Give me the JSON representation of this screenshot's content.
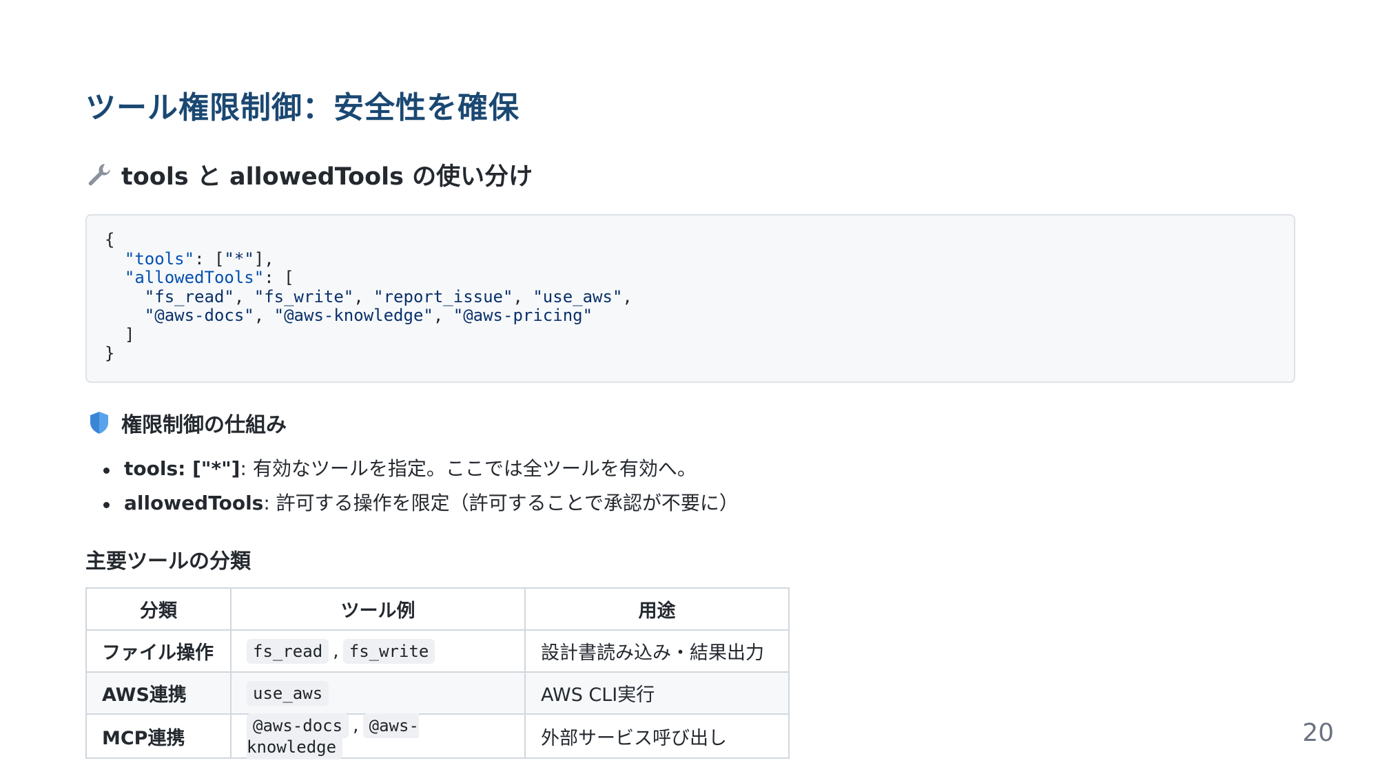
{
  "title": "ツール権限制御：安全性を確保",
  "section_tools": {
    "icon": "wrench-icon",
    "heading": "tools と allowedTools の使い分け"
  },
  "code": {
    "lines": [
      "{",
      "  \"tools\": [\"*\"],",
      "  \"allowedTools\": [",
      "    \"fs_read\", \"fs_write\", \"report_issue\", \"use_aws\",",
      "    \"@aws-docs\", \"@aws-knowledge\", \"@aws-pricing\"",
      "  ]",
      "}"
    ]
  },
  "section_perm": {
    "icon": "shield-icon",
    "heading": "権限制御の仕組み",
    "bullets": [
      {
        "term": "tools: [\"*\"]",
        "text": ": 有効なツールを指定。ここでは全ツールを有効へ。"
      },
      {
        "term": "allowedTools",
        "text": ": 許可する操作を限定（許可することで承認が不要に）"
      }
    ]
  },
  "section_table": {
    "heading": "主要ツールの分類",
    "columns": [
      "分類",
      "ツール例",
      "用途"
    ],
    "rows": [
      {
        "category": "ファイル操作",
        "tools": [
          "fs_read",
          "fs_write"
        ],
        "use": "設計書読み込み・結果出力"
      },
      {
        "category": "AWS連携",
        "tools": [
          "use_aws"
        ],
        "use": "AWS CLI実行"
      },
      {
        "category": "MCP連携",
        "tools": [
          "@aws-docs",
          "@aws-knowledge"
        ],
        "use": "外部サービス呼び出し"
      }
    ]
  },
  "page_number": "20",
  "colors": {
    "title": "#1a4872",
    "code_bg": "#f6f8fa",
    "string": "#0a3069"
  }
}
